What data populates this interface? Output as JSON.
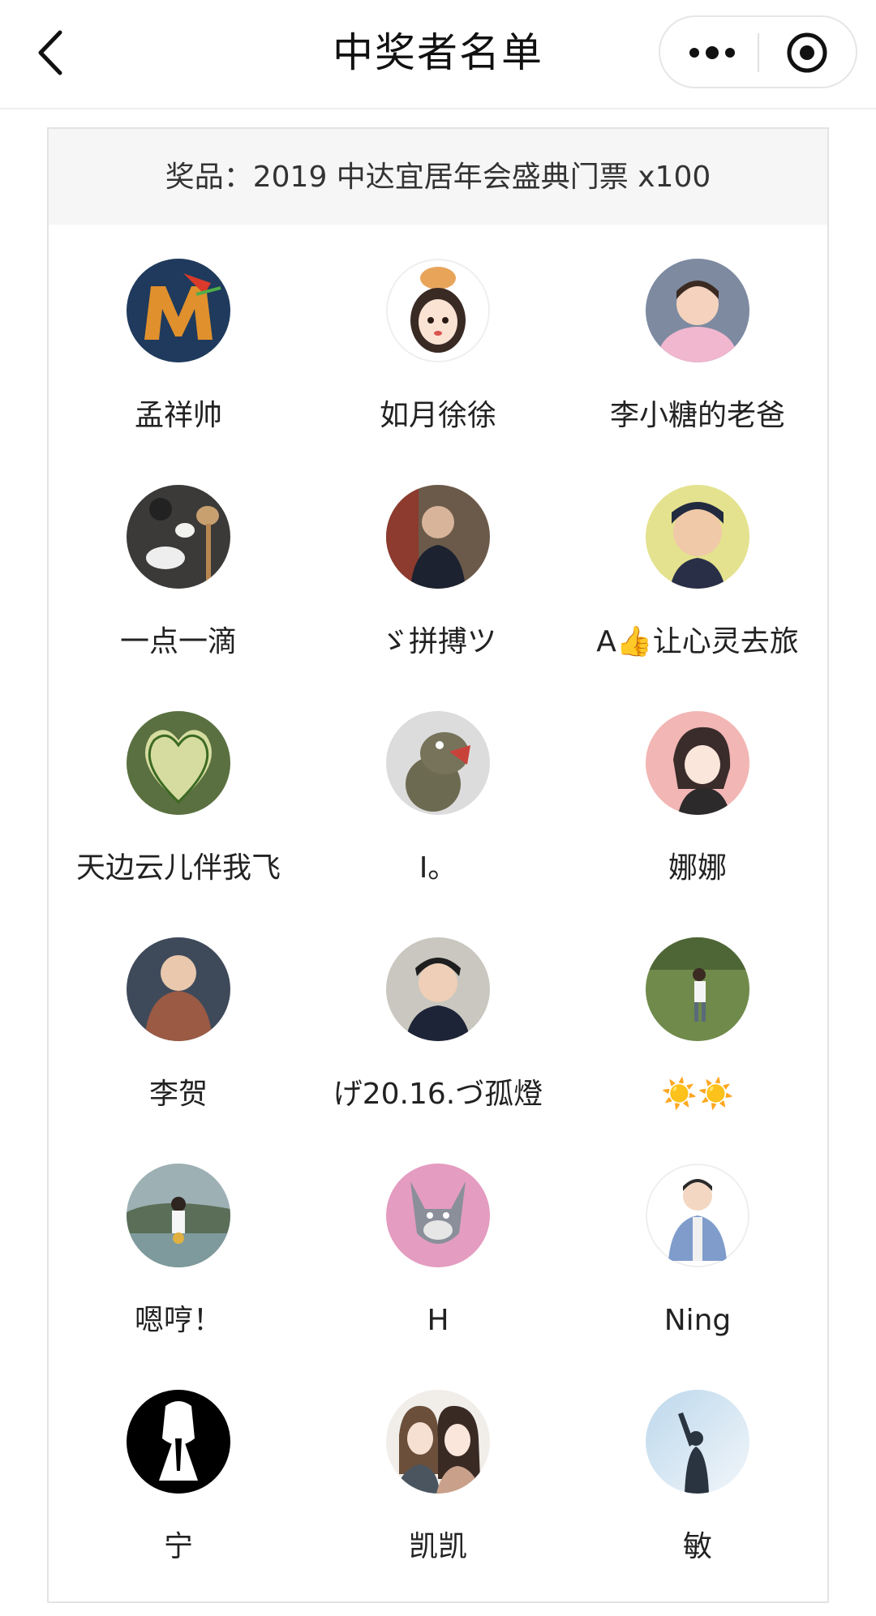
{
  "header": {
    "title": "中奖者名单"
  },
  "prize": {
    "text": "奖品：2019 中达宜居年会盛典门票 x100"
  },
  "winners": [
    {
      "name": "孟祥帅"
    },
    {
      "name": "如月徐徐"
    },
    {
      "name": "李小糖的老爸"
    },
    {
      "name": "一点一滴"
    },
    {
      "name": "ゞ拼搏ツ"
    },
    {
      "name": "A👍让心灵去旅"
    },
    {
      "name": "天边云儿伴我飞"
    },
    {
      "name": "I。"
    },
    {
      "name": "娜娜"
    },
    {
      "name": "李贺"
    },
    {
      "name": "げ20.16.づ孤燈"
    },
    {
      "name": "☀️☀️"
    },
    {
      "name": "嗯哼！"
    },
    {
      "name": "H"
    },
    {
      "name": "Ning"
    },
    {
      "name": "宁"
    },
    {
      "name": "凯凯"
    },
    {
      "name": "敏"
    }
  ],
  "colors": {
    "background": "#ffffff",
    "prize_bar": "#f6f6f6",
    "border": "#e3e3e3"
  }
}
